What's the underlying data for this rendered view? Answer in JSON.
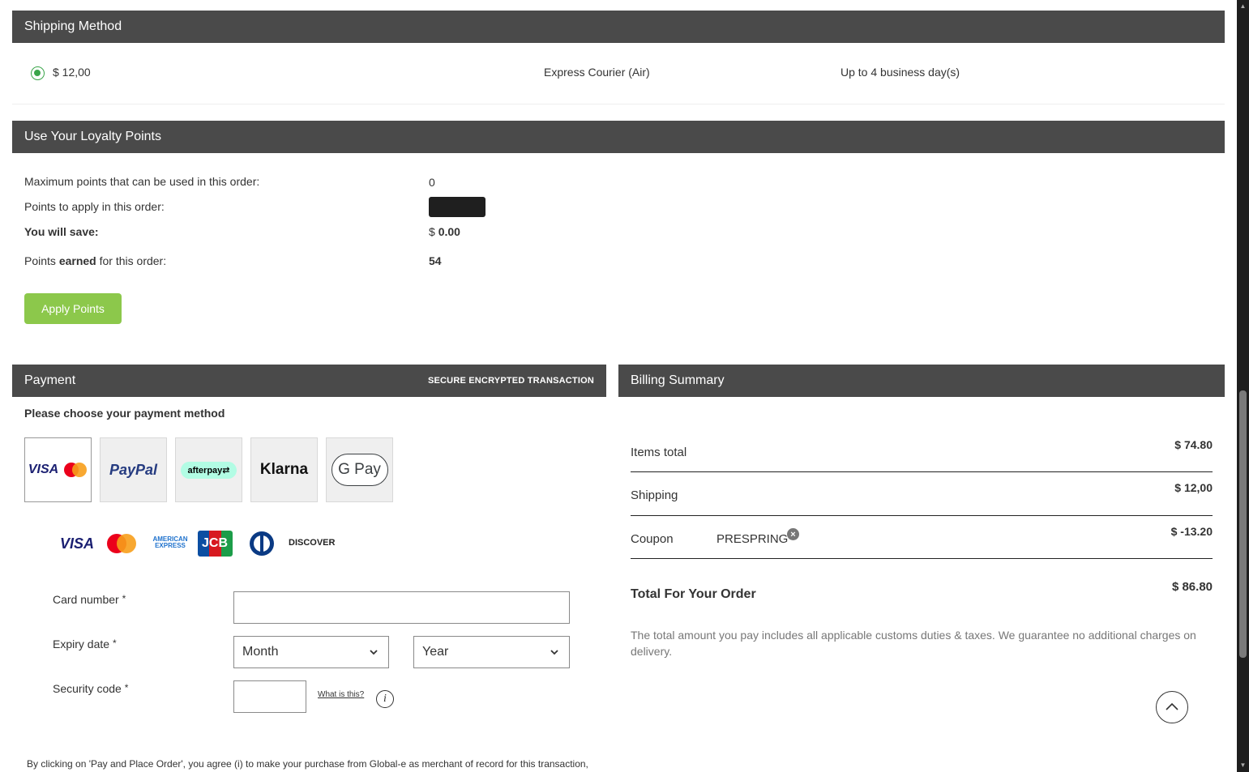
{
  "shipping": {
    "header": "Shipping Method",
    "option": {
      "price": "$ 12,00",
      "service": "Express Courier (Air)",
      "eta": "Up to 4 business day(s)"
    }
  },
  "loyalty": {
    "header": "Use Your Loyalty Points",
    "max_label": "Maximum points that can be used in this order:",
    "max_value": "0",
    "apply_label": "Points to apply in this order:",
    "save_label": "You will save:",
    "save_currency": "$",
    "save_value": "0.00",
    "earned_pre": "Points ",
    "earned_bold": "earned",
    "earned_post": " for this order:",
    "earned_value": "54",
    "apply_button": "Apply Points"
  },
  "payment": {
    "header": "Payment",
    "secure": "SECURE ENCRYPTED TRANSACTION",
    "choose": "Please choose your payment method",
    "methods": [
      "VISA",
      "PayPal",
      "afterpay",
      "Klarna",
      "G Pay"
    ],
    "cards": [
      "VISA",
      "AMERICAN EXPRESS",
      "JCB",
      "DISCOVER"
    ],
    "card_number_label": "Card number",
    "expiry_label": "Expiry date",
    "month_placeholder": "Month",
    "year_placeholder": "Year",
    "security_label": "Security code",
    "required_mark": "*",
    "what_is_this": "What is this?",
    "info_icon_glyph": "i",
    "terms": "By clicking on 'Pay and Place Order', you agree (i) to make your purchase from Global-e as merchant of record for this transaction,"
  },
  "billing": {
    "header": "Billing Summary",
    "items_label": "Items total",
    "items_value": "$ 74.80",
    "shipping_label": "Shipping",
    "shipping_value": "$ 12,00",
    "coupon_label": "Coupon",
    "coupon_code": "PRESPRING",
    "coupon_value": "$ -13.20",
    "total_label": "Total For Your Order",
    "total_value": "$ 86.80",
    "note": "The total amount you pay includes all applicable customs duties & taxes. We guarantee no additional charges on delivery."
  },
  "colors": {
    "header_bg": "#4a4a4a",
    "apply_button": "#8cc84b",
    "radio": "#3aa54a"
  }
}
